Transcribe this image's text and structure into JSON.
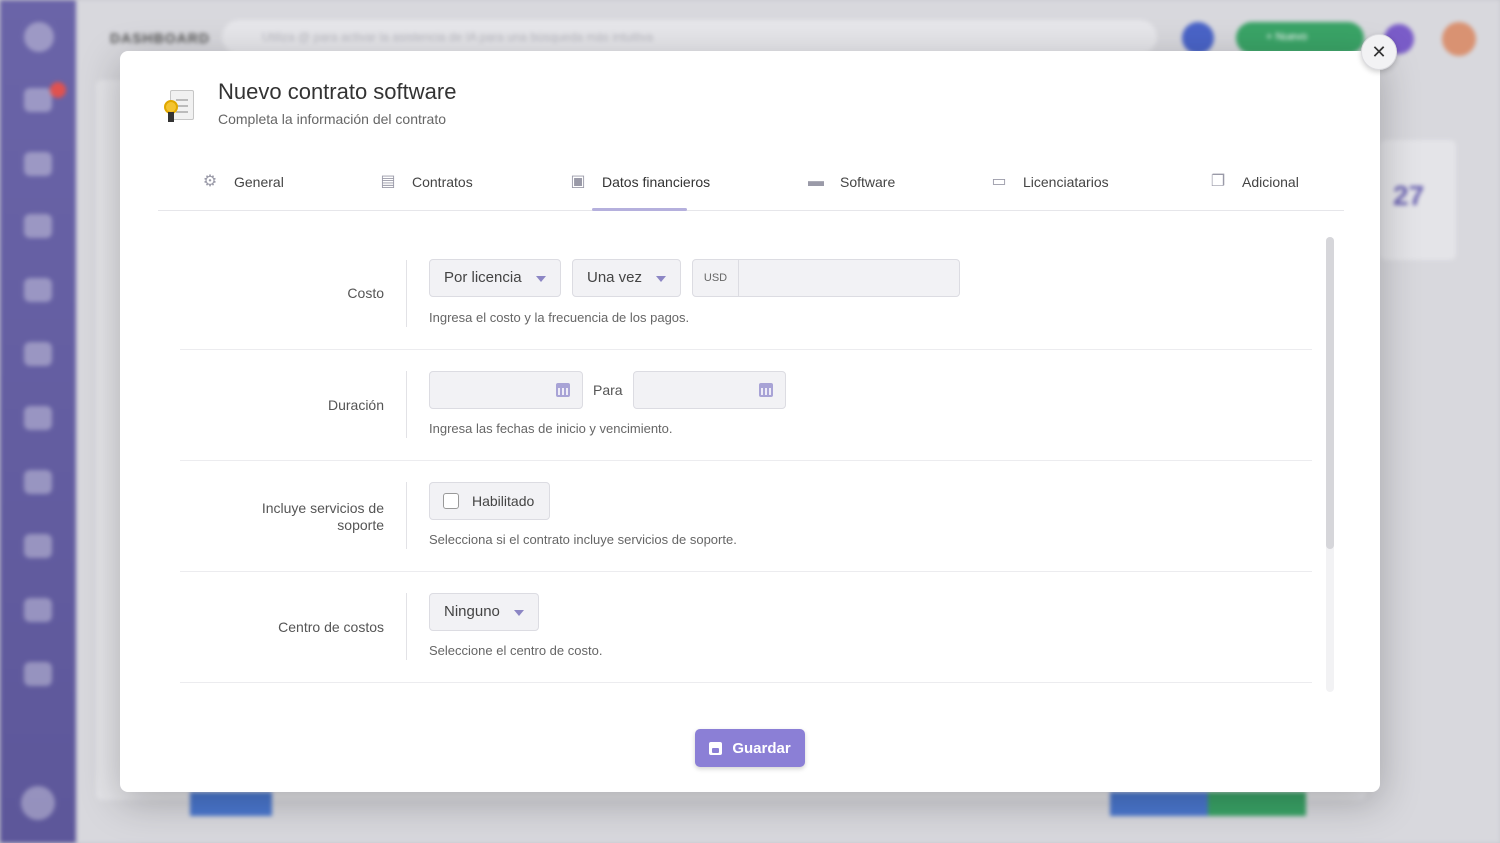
{
  "background": {
    "page_title": "DASHBOARD",
    "search_placeholder": "Utiliza @ para activar la asistencia de IA para una búsqueda más intuitiva",
    "new_button": "+ Nuevo",
    "notification_count": "6",
    "stat_value": "27"
  },
  "modal": {
    "title": "Nuevo contrato software",
    "subtitle": "Completa la información del contrato",
    "close_label": "✕",
    "tabs": [
      {
        "label": "General",
        "icon": "gears-icon"
      },
      {
        "label": "Contratos",
        "icon": "contract-icon"
      },
      {
        "label": "Datos financieros",
        "icon": "money-icon",
        "active": true
      },
      {
        "label": "Software",
        "icon": "window-icon"
      },
      {
        "label": "Licenciatarios",
        "icon": "devices-icon"
      },
      {
        "label": "Adicional",
        "icon": "copy-icon"
      }
    ],
    "fields": {
      "cost": {
        "label": "Costo",
        "type_value": "Por licencia",
        "frequency_value": "Una vez",
        "currency": "USD",
        "amount_value": "",
        "help": "Ingresa el costo y la frecuencia de los pagos."
      },
      "duration": {
        "label": "Duración",
        "start_value": "",
        "separator": "Para",
        "end_value": "",
        "help": "Ingresa las fechas de inicio y vencimiento."
      },
      "support": {
        "label": "Incluye servicios de soporte",
        "checkbox_label": "Habilitado",
        "checked": false,
        "help": "Selecciona si el contrato incluye servicios de soporte."
      },
      "cost_center": {
        "label": "Centro de costos",
        "value": "Ninguno",
        "help": "Seleccione el centro de costo."
      }
    },
    "save_label": "Guardar"
  }
}
